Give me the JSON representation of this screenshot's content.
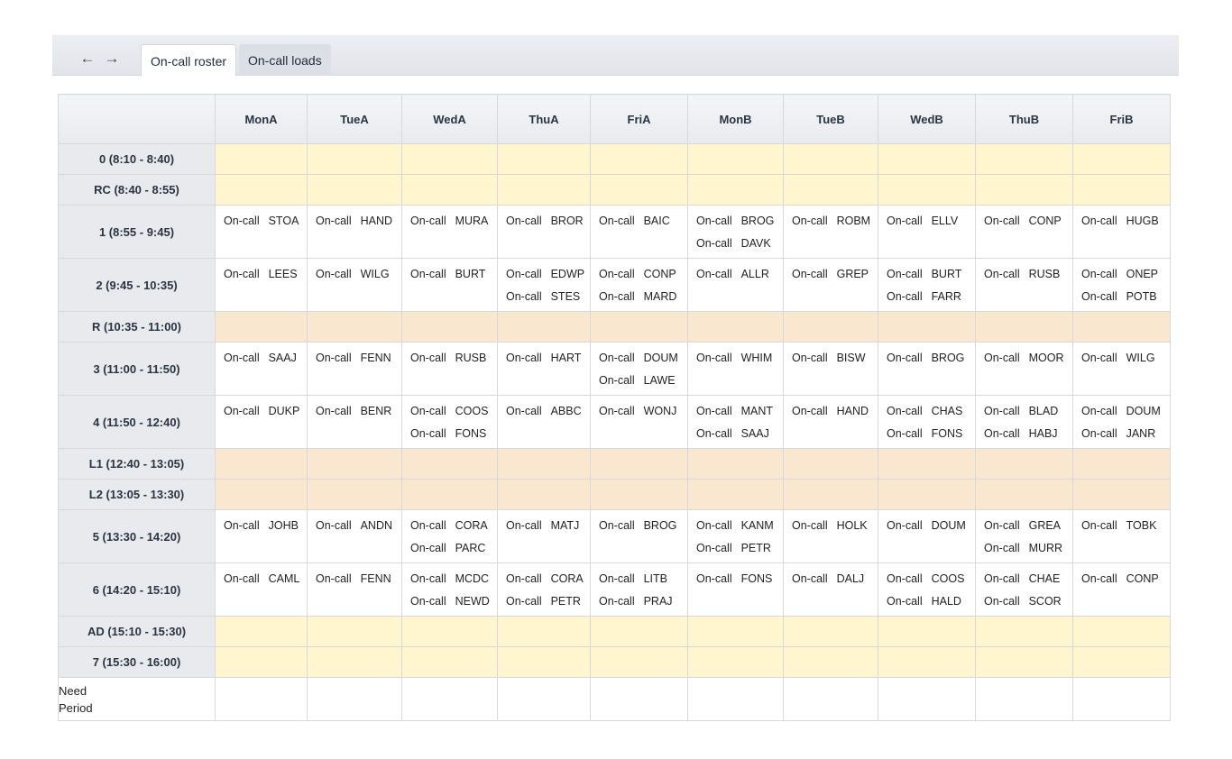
{
  "tabs": [
    {
      "label": "On-call roster",
      "active": true
    },
    {
      "label": "On-call loads",
      "active": false
    }
  ],
  "columns": [
    "MonA",
    "TueA",
    "WedA",
    "ThuA",
    "FriA",
    "MonB",
    "TueB",
    "WedB",
    "ThuB",
    "FriB"
  ],
  "footer": {
    "line1": "Need",
    "line2": "Period"
  },
  "rows": [
    {
      "label": "0  (8:10 - 8:40)",
      "type": "break-light",
      "cells": [
        [],
        [],
        [],
        [],
        [],
        [],
        [],
        [],
        [],
        []
      ]
    },
    {
      "label": "RC  (8:40 - 8:55)",
      "type": "break-light",
      "cells": [
        [],
        [],
        [],
        [],
        [],
        [],
        [],
        [],
        [],
        []
      ]
    },
    {
      "label": "1  (8:55 - 9:45)",
      "type": "period",
      "cells": [
        [
          {
            "label": "On-call",
            "code": "STOA"
          }
        ],
        [
          {
            "label": "On-call",
            "code": "HAND"
          }
        ],
        [
          {
            "label": "On-call",
            "code": "MURA"
          }
        ],
        [
          {
            "label": "On-call",
            "code": "BROR"
          }
        ],
        [
          {
            "label": "On-call",
            "code": "BAIC"
          }
        ],
        [
          {
            "label": "On-call",
            "code": "BROG"
          },
          {
            "label": "On-call",
            "code": "DAVK"
          }
        ],
        [
          {
            "label": "On-call",
            "code": "ROBM"
          }
        ],
        [
          {
            "label": "On-call",
            "code": "ELLV"
          }
        ],
        [
          {
            "label": "On-call",
            "code": "CONP"
          }
        ],
        [
          {
            "label": "On-call",
            "code": "HUGB"
          }
        ]
      ]
    },
    {
      "label": "2  (9:45 - 10:35)",
      "type": "period",
      "cells": [
        [
          {
            "label": "On-call",
            "code": "LEES"
          }
        ],
        [
          {
            "label": "On-call",
            "code": "WILG"
          }
        ],
        [
          {
            "label": "On-call",
            "code": "BURT"
          }
        ],
        [
          {
            "label": "On-call",
            "code": "EDWP"
          },
          {
            "label": "On-call",
            "code": "STES"
          }
        ],
        [
          {
            "label": "On-call",
            "code": "CONP"
          },
          {
            "label": "On-call",
            "code": "MARD"
          }
        ],
        [
          {
            "label": "On-call",
            "code": "ALLR"
          }
        ],
        [
          {
            "label": "On-call",
            "code": "GREP"
          }
        ],
        [
          {
            "label": "On-call",
            "code": "BURT"
          },
          {
            "label": "On-call",
            "code": "FARR"
          }
        ],
        [
          {
            "label": "On-call",
            "code": "RUSB"
          }
        ],
        [
          {
            "label": "On-call",
            "code": "ONEP"
          },
          {
            "label": "On-call",
            "code": "POTB"
          }
        ]
      ]
    },
    {
      "label": "R  (10:35 - 11:00)",
      "type": "break-dark",
      "cells": [
        [],
        [],
        [],
        [],
        [],
        [],
        [],
        [],
        [],
        []
      ]
    },
    {
      "label": "3  (11:00 - 11:50)",
      "type": "period",
      "cells": [
        [
          {
            "label": "On-call",
            "code": "SAAJ"
          }
        ],
        [
          {
            "label": "On-call",
            "code": "FENN"
          }
        ],
        [
          {
            "label": "On-call",
            "code": "RUSB"
          }
        ],
        [
          {
            "label": "On-call",
            "code": "HART"
          }
        ],
        [
          {
            "label": "On-call",
            "code": "DOUM"
          },
          {
            "label": "On-call",
            "code": "LAWE"
          }
        ],
        [
          {
            "label": "On-call",
            "code": "WHIM"
          }
        ],
        [
          {
            "label": "On-call",
            "code": "BISW"
          }
        ],
        [
          {
            "label": "On-call",
            "code": "BROG"
          }
        ],
        [
          {
            "label": "On-call",
            "code": "MOOR"
          }
        ],
        [
          {
            "label": "On-call",
            "code": "WILG"
          }
        ]
      ]
    },
    {
      "label": "4  (11:50 - 12:40)",
      "type": "period",
      "cells": [
        [
          {
            "label": "On-call",
            "code": "DUKP"
          }
        ],
        [
          {
            "label": "On-call",
            "code": "BENR"
          }
        ],
        [
          {
            "label": "On-call",
            "code": "COOS"
          },
          {
            "label": "On-call",
            "code": "FONS"
          }
        ],
        [
          {
            "label": "On-call",
            "code": "ABBC"
          }
        ],
        [
          {
            "label": "On-call",
            "code": "WONJ"
          }
        ],
        [
          {
            "label": "On-call",
            "code": "MANT"
          },
          {
            "label": "On-call",
            "code": "SAAJ"
          }
        ],
        [
          {
            "label": "On-call",
            "code": "HAND"
          }
        ],
        [
          {
            "label": "On-call",
            "code": "CHAS"
          },
          {
            "label": "On-call",
            "code": "FONS"
          }
        ],
        [
          {
            "label": "On-call",
            "code": "BLAD"
          },
          {
            "label": "On-call",
            "code": "HABJ"
          }
        ],
        [
          {
            "label": "On-call",
            "code": "DOUM"
          },
          {
            "label": "On-call",
            "code": "JANR"
          }
        ]
      ]
    },
    {
      "label": "L1  (12:40 - 13:05)",
      "type": "break-dark",
      "cells": [
        [],
        [],
        [],
        [],
        [],
        [],
        [],
        [],
        [],
        []
      ]
    },
    {
      "label": "L2  (13:05 - 13:30)",
      "type": "break-dark",
      "cells": [
        [],
        [],
        [],
        [],
        [],
        [],
        [],
        [],
        [],
        []
      ]
    },
    {
      "label": "5  (13:30 - 14:20)",
      "type": "period",
      "cells": [
        [
          {
            "label": "On-call",
            "code": "JOHB"
          }
        ],
        [
          {
            "label": "On-call",
            "code": "ANDN"
          }
        ],
        [
          {
            "label": "On-call",
            "code": "CORA"
          },
          {
            "label": "On-call",
            "code": "PARC"
          }
        ],
        [
          {
            "label": "On-call",
            "code": "MATJ"
          }
        ],
        [
          {
            "label": "On-call",
            "code": "BROG"
          }
        ],
        [
          {
            "label": "On-call",
            "code": "KANM"
          },
          {
            "label": "On-call",
            "code": "PETR"
          }
        ],
        [
          {
            "label": "On-call",
            "code": "HOLK"
          }
        ],
        [
          {
            "label": "On-call",
            "code": "DOUM"
          }
        ],
        [
          {
            "label": "On-call",
            "code": "GREA"
          },
          {
            "label": "On-call",
            "code": "MURR"
          }
        ],
        [
          {
            "label": "On-call",
            "code": "TOBK"
          }
        ]
      ]
    },
    {
      "label": "6  (14:20 - 15:10)",
      "type": "period",
      "cells": [
        [
          {
            "label": "On-call",
            "code": "CAML"
          }
        ],
        [
          {
            "label": "On-call",
            "code": "FENN"
          }
        ],
        [
          {
            "label": "On-call",
            "code": "MCDC"
          },
          {
            "label": "On-call",
            "code": "NEWD"
          }
        ],
        [
          {
            "label": "On-call",
            "code": "CORA"
          },
          {
            "label": "On-call",
            "code": "PETR"
          }
        ],
        [
          {
            "label": "On-call",
            "code": "LITB"
          },
          {
            "label": "On-call",
            "code": "PRAJ"
          }
        ],
        [
          {
            "label": "On-call",
            "code": "FONS"
          }
        ],
        [
          {
            "label": "On-call",
            "code": "DALJ"
          }
        ],
        [
          {
            "label": "On-call",
            "code": "COOS"
          },
          {
            "label": "On-call",
            "code": "HALD"
          }
        ],
        [
          {
            "label": "On-call",
            "code": "CHAE"
          },
          {
            "label": "On-call",
            "code": "SCOR"
          }
        ],
        [
          {
            "label": "On-call",
            "code": "CONP"
          }
        ]
      ]
    },
    {
      "label": "AD  (15:10 - 15:30)",
      "type": "break-light",
      "cells": [
        [],
        [],
        [],
        [],
        [],
        [],
        [],
        [],
        [],
        []
      ]
    },
    {
      "label": "7  (15:30 - 16:00)",
      "type": "break-light",
      "cells": [
        [],
        [],
        [],
        [],
        [],
        [],
        [],
        [],
        [],
        []
      ]
    }
  ]
}
